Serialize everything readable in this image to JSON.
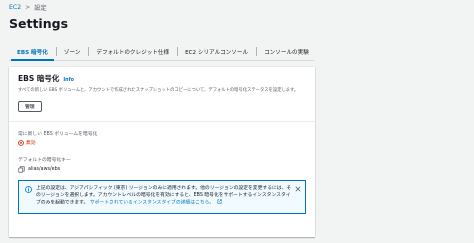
{
  "breadcrumb": {
    "root": "EC2",
    "separator": ">",
    "current": "設定"
  },
  "page": {
    "title": "Settings"
  },
  "tabs": [
    {
      "label": "EBS 暗号化",
      "active": true
    },
    {
      "label": "ゾーン",
      "active": false
    },
    {
      "label": "デフォルトのクレジット仕様",
      "active": false
    },
    {
      "label": "EC2 シリアルコンソール",
      "active": false
    },
    {
      "label": "コンソールの実験",
      "active": false
    }
  ],
  "ebs_panel": {
    "title": "EBS 暗号化",
    "info_label": "Info",
    "description": "すべての新しい EBS ボリュームと、アカウントで作成されたスナップショットのコピーについて、デフォルトの暗号化ステータスを設定します。",
    "manage_label": "管理",
    "always_encrypt_label": "常に新しい EBS ボリュームを暗号化",
    "always_encrypt_status": "無効",
    "default_key_label": "デフォルトの暗号化キー",
    "default_key_value": "alias/aws/ebs"
  },
  "alert": {
    "text": "上記の設定は、アジアパシフィック (東京) リージョンのみに適用されます。他のリージョンの設定を変更するには、そのリージョンを選択します。アカウントレベルの暗号化を有効にすると、EBS 暗号化をサポートするインスタンスタイプのみを起動できます。",
    "link": "サポートされているインスタンスタイプの詳細はこちら。"
  },
  "colors": {
    "link": "#0073bb",
    "error": "#d13212",
    "info_border": "#0073bb",
    "info_bg": "#f1faff"
  },
  "icons": [
    "status-negative-icon",
    "copy-icon",
    "info-circle-icon",
    "external-link-icon",
    "close-icon"
  ]
}
